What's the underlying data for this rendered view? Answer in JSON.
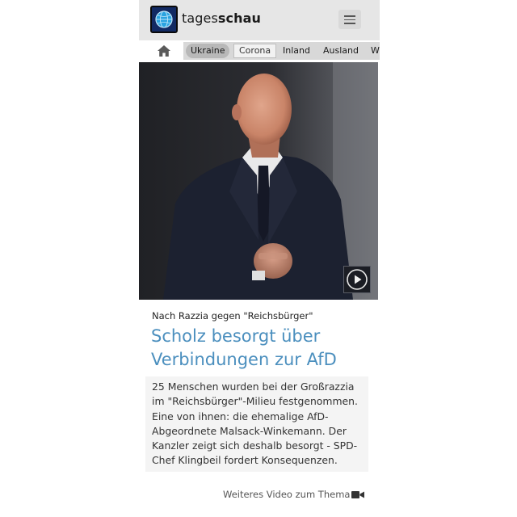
{
  "header": {
    "brand_part1": "tages",
    "brand_part2": "schau",
    "logo_icon": "tagesschau-globe-logo-icon",
    "menu_icon": "hamburger-menu-icon"
  },
  "nav": {
    "home_icon": "home-icon",
    "tabs": [
      {
        "label": "Ukraine"
      },
      {
        "label": "Corona"
      },
      {
        "label": "Inland"
      },
      {
        "label": "Ausland"
      },
      {
        "label": "W"
      }
    ]
  },
  "article": {
    "kicker": "Nach Razzia gegen \"Reichsbürger\"",
    "headline": "Scholz besorgt über Verbindungen zur AfD",
    "teaser": "25 Menschen wurden bei der Großrazzia im \"Reichsbürger\"-Milieu festgenommen. Eine von ihnen: die ehemalige AfD-Abgeordnete Malsack-Winkemann. Der Kanzler zeigt sich deshalb besorgt - SPD-Chef Klingbeil fordert Konsequenzen.",
    "play_icon": "play-icon",
    "more_video": "Weiteres Video zum Thema",
    "video_icon": "video-camera-icon"
  },
  "colors": {
    "header_bg": "#e6e6e6",
    "headline": "#4b8fbe",
    "logo_bg": "#0f1f4a"
  }
}
